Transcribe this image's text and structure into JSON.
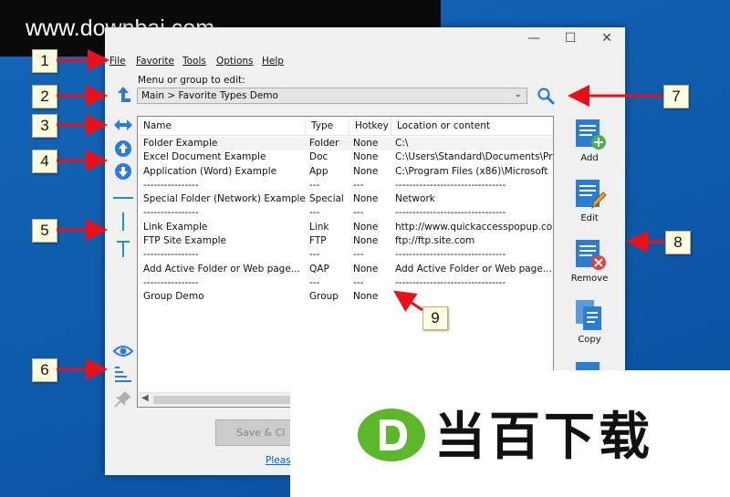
{
  "watermark": {
    "site": "www.downbai.com",
    "brand": "当百下载"
  },
  "window": {
    "controls": {
      "minimize": "—",
      "maximize": "☐",
      "close": "✕"
    },
    "menu": [
      "File",
      "Favorite",
      "Tools",
      "Options",
      "Help"
    ],
    "edit_label": "Menu or group to edit:",
    "combo_value": "Main > Favorite Types Demo",
    "list": {
      "columns": [
        "Name",
        "Type",
        "Hotkey",
        "Location or content"
      ],
      "rows": [
        [
          "Folder Example",
          "Folder",
          "None",
          "C:\\"
        ],
        [
          "Excel Document Example",
          "Doc",
          "None",
          "C:\\Users\\Standard\\Documents\\Pr"
        ],
        [
          "Application (Word) Example",
          "App",
          "None",
          "C:\\Program Files (x86)\\Microsoft"
        ],
        [
          "----------------",
          "---",
          "---",
          "--------------------------------"
        ],
        [
          "Special Folder (Network) Example",
          "Special",
          "None",
          "Network"
        ],
        [
          "----------------",
          "---",
          "---",
          "--------------------------------"
        ],
        [
          "Link Example",
          "Link",
          "None",
          "http://www.quickaccesspopup.com"
        ],
        [
          "FTP Site Example",
          "FTP",
          "None",
          "ftp://ftp.site.com"
        ],
        [
          "----------------",
          "---",
          "---",
          "--------------------------------"
        ],
        [
          "Add Active Folder or Web page...",
          "QAP",
          "None",
          "Add Active Folder or Web page..."
        ],
        [
          "----------------",
          "---",
          "---",
          "--------------------------------"
        ],
        [
          "Group Demo",
          "Group",
          "None",
          ""
        ]
      ]
    },
    "actions": {
      "add": "Add",
      "edit": "Edit",
      "remove": "Remove",
      "copy": "Copy"
    },
    "save_label": "Save & Cl",
    "link_label": "Please"
  },
  "callouts": [
    "1",
    "2",
    "3",
    "4",
    "5",
    "6",
    "7",
    "8",
    "9"
  ],
  "colors": {
    "desktop": "#0c5db0",
    "accent_blue": "#2b7cd3",
    "teal": "#1b9aaa",
    "add_green": "#4caf50",
    "remove_red": "#e04040",
    "callout_arrow": "#e8101a",
    "logo_green": "#5cb82a"
  }
}
